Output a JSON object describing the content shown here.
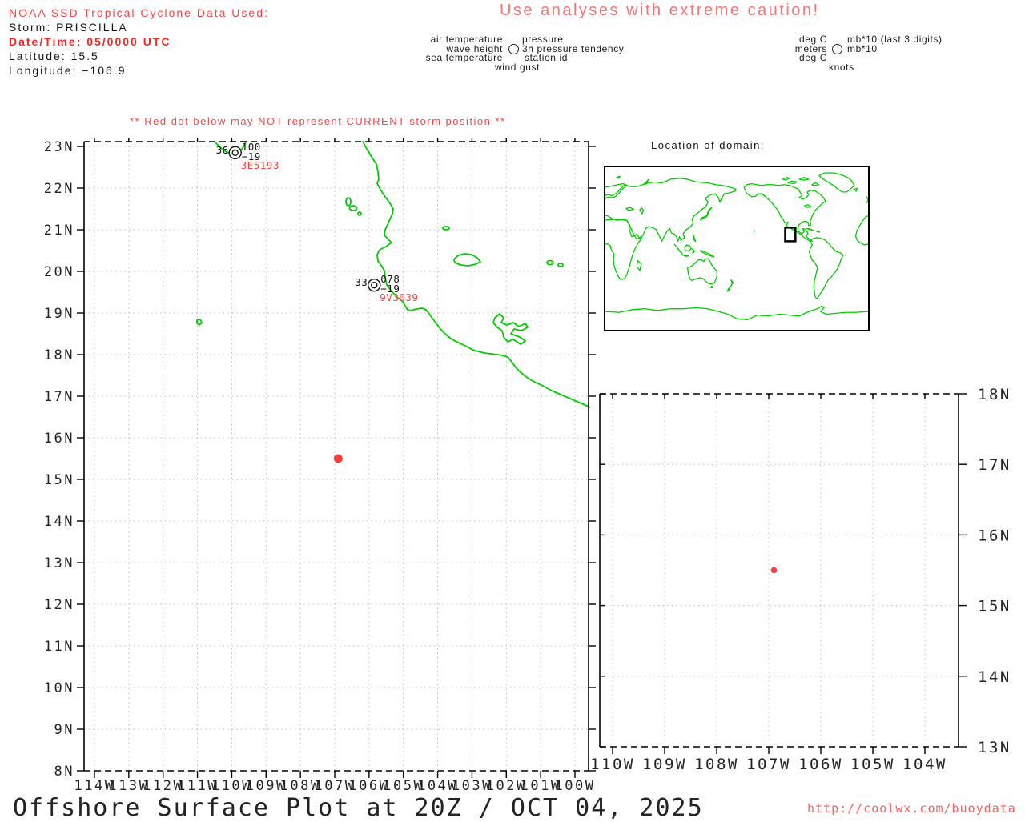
{
  "colors": {
    "text_red": "#fb4545",
    "bold_red": "#ff2222",
    "warning_red": "#f97272",
    "coast_green": "#00cc00",
    "storm_red": "#f93c3c",
    "grid_gray": "#b9b9b9"
  },
  "header": {
    "line1": "NOAA SSD Tropical Cyclone Data Used:",
    "line2": "Storm: PRISCILLA",
    "line3": "Date/Time: 05/0000 UTC",
    "line4": "Latitude: 15.5",
    "line5": "Longitude: −106.9"
  },
  "warning_top": "Use analyses with extreme caution!",
  "warning_map": "** Red dot below may NOT represent CURRENT storm position **",
  "legend_plot": {
    "row1_left": "air temperature",
    "row1_right": "pressure",
    "row2_left": "wave height",
    "row2_right": "3h pressure tendency",
    "row3_left": "sea temperature",
    "row3_right": "station id",
    "row4_center": "wind gust"
  },
  "legend_units": {
    "row1_left": "deg C",
    "row1_right": "mb*10 (last 3 digits)",
    "row2_left": "meters",
    "row2_right": "mb*10",
    "row3_left": "deg C",
    "row4_center": "knots"
  },
  "inset": {
    "title": "Location of domain:"
  },
  "footer": {
    "title": "Offshore Surface Plot at 20Z / OCT 04, 2025",
    "url": "http://coolwx.com/buoydata"
  },
  "chart_data": [
    {
      "id": "main-map",
      "type": "map",
      "lon_ticks": {
        "values": [
          114,
          113,
          112,
          111,
          110,
          109,
          108,
          107,
          106,
          105,
          104,
          103,
          102,
          101,
          100
        ],
        "labels": [
          "114W",
          "113W",
          "112W",
          "111W",
          "110W",
          "109W",
          "108W",
          "107W",
          "106W",
          "105W",
          "104W",
          "103W",
          "102W",
          "101W",
          "100W"
        ]
      },
      "lat_ticks": {
        "values": [
          23,
          22,
          21,
          20,
          19,
          18,
          17,
          16,
          15,
          14,
          13,
          12,
          11,
          10,
          9,
          8
        ],
        "labels": [
          "23N",
          "22N",
          "21N",
          "20N",
          "19N",
          "18N",
          "17N",
          "16N",
          "15N",
          "14N",
          "13N",
          "12N",
          "11N",
          "10N",
          "9N",
          "8N"
        ]
      },
      "storm": {
        "lat": 15.5,
        "lon": -106.9
      },
      "stations": [
        {
          "id": "3E5193",
          "lat": 22.85,
          "lon": -109.9,
          "air_temp": "36",
          "pressure": "100",
          "tendency_3h": "−19"
        },
        {
          "id": "9V3039",
          "lat": 19.67,
          "lon": -105.85,
          "air_temp": "33",
          "pressure": "078",
          "tendency_3h": "−19"
        }
      ]
    },
    {
      "id": "domain-inset",
      "type": "world-map",
      "domain_box": {
        "lat_min": 8,
        "lat_max": 23,
        "lon_min": -114,
        "lon_max": -100
      }
    },
    {
      "id": "zoom-map",
      "type": "map",
      "lon_ticks": {
        "values": [
          110,
          109,
          108,
          107,
          106,
          105,
          104
        ],
        "labels": [
          "110W",
          "109W",
          "108W",
          "107W",
          "106W",
          "105W",
          "104W"
        ]
      },
      "lat_ticks": {
        "values": [
          18,
          17,
          16,
          15,
          14,
          13
        ],
        "labels": [
          "18N",
          "17N",
          "16N",
          "15N",
          "14N",
          "13N"
        ]
      },
      "storm": {
        "lat": 15.5,
        "lon": -106.9
      }
    }
  ]
}
